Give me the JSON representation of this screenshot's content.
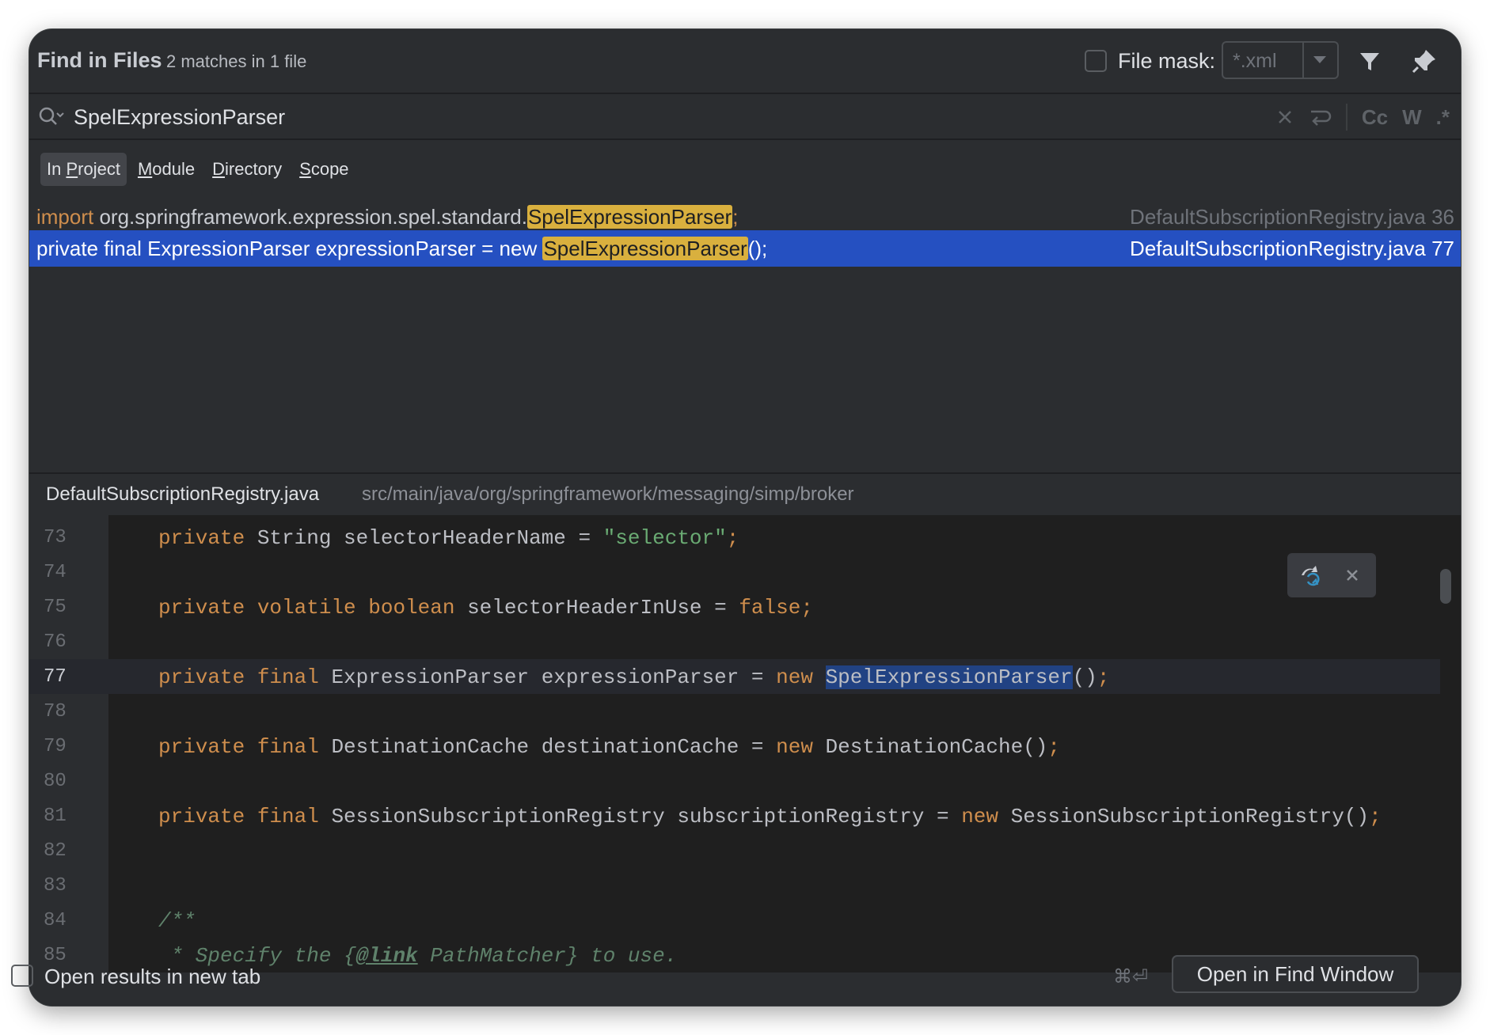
{
  "header": {
    "title": "Find in Files",
    "subtitle": "2 matches in 1 file",
    "file_mask_label": "File mask:",
    "file_mask_value": "*.xml"
  },
  "search": {
    "query": "SpelExpressionParser",
    "tools": {
      "match_case": "Cc",
      "words": "W",
      "regex": ".*"
    }
  },
  "scope_tabs": [
    {
      "pre": "In ",
      "u": "P",
      "post": "roject",
      "active": true
    },
    {
      "pre": "",
      "u": "M",
      "post": "odule",
      "active": false
    },
    {
      "pre": "",
      "u": "D",
      "post": "irectory",
      "active": false
    },
    {
      "pre": "",
      "u": "S",
      "post": "cope",
      "active": false
    }
  ],
  "results": [
    {
      "keyword": "import",
      "before": " org.springframework.expression.spel.standard.",
      "match": "SpelExpressionParser",
      "after": ";",
      "location": "DefaultSubscriptionRegistry.java 36",
      "selected": false
    },
    {
      "keyword": "",
      "before": "private final ExpressionParser expressionParser = new ",
      "match": "SpelExpressionParser",
      "after": "();",
      "location": "DefaultSubscriptionRegistry.java 77",
      "selected": true
    }
  ],
  "preview": {
    "file": "DefaultSubscriptionRegistry.java",
    "path": "src/main/java/org/springframework/messaging/simp/broker"
  },
  "code_lines": [
    {
      "num": "73",
      "parts": [
        [
          "kw",
          "private"
        ],
        [
          "txt",
          " String selectorHeaderName = "
        ],
        [
          "str",
          "\"selector\""
        ],
        [
          "kw",
          ";"
        ]
      ]
    },
    {
      "num": "74",
      "parts": []
    },
    {
      "num": "75",
      "parts": [
        [
          "kw",
          "private volatile boolean"
        ],
        [
          "txt",
          " selectorHeaderInUse = "
        ],
        [
          "kw",
          "false;"
        ]
      ]
    },
    {
      "num": "76",
      "parts": []
    },
    {
      "num": "77",
      "current": true,
      "parts": [
        [
          "kw",
          "private final"
        ],
        [
          "txt",
          " ExpressionParser expressionParser = "
        ],
        [
          "kw",
          "new"
        ],
        [
          "txt",
          " "
        ],
        [
          "sel",
          "SpelExpressionParser"
        ],
        [
          "txt",
          "()"
        ],
        [
          "kw",
          ";"
        ]
      ]
    },
    {
      "num": "78",
      "parts": []
    },
    {
      "num": "79",
      "parts": [
        [
          "kw",
          "private final"
        ],
        [
          "txt",
          " DestinationCache destinationCache = "
        ],
        [
          "kw",
          "new"
        ],
        [
          "txt",
          " DestinationCache()"
        ],
        [
          "kw",
          ";"
        ]
      ]
    },
    {
      "num": "80",
      "parts": []
    },
    {
      "num": "81",
      "parts": [
        [
          "kw",
          "private final"
        ],
        [
          "txt",
          " SessionSubscriptionRegistry subscriptionRegistry = "
        ],
        [
          "kw",
          "new"
        ],
        [
          "txt",
          " SessionSubscriptionRegistry()"
        ],
        [
          "kw",
          ";"
        ]
      ]
    },
    {
      "num": "82",
      "parts": []
    },
    {
      "num": "83",
      "parts": []
    },
    {
      "num": "84",
      "parts": [
        [
          "doc",
          "/**"
        ]
      ]
    },
    {
      "num": "85",
      "parts": [
        [
          "doc",
          " * Specify the {"
        ],
        [
          "doctag",
          "@link"
        ],
        [
          "doc",
          " PathMatcher} to use."
        ]
      ]
    }
  ],
  "footer": {
    "open_new_tab_label": "Open results in new tab",
    "shortcut": "⌘⏎",
    "open_button": "Open in Find Window"
  },
  "icons": {
    "filter": "filter-icon",
    "pin": "pin-icon",
    "search": "search-history-icon",
    "clear": "clear-icon",
    "newline": "newline-icon",
    "float": "sync-icon"
  }
}
